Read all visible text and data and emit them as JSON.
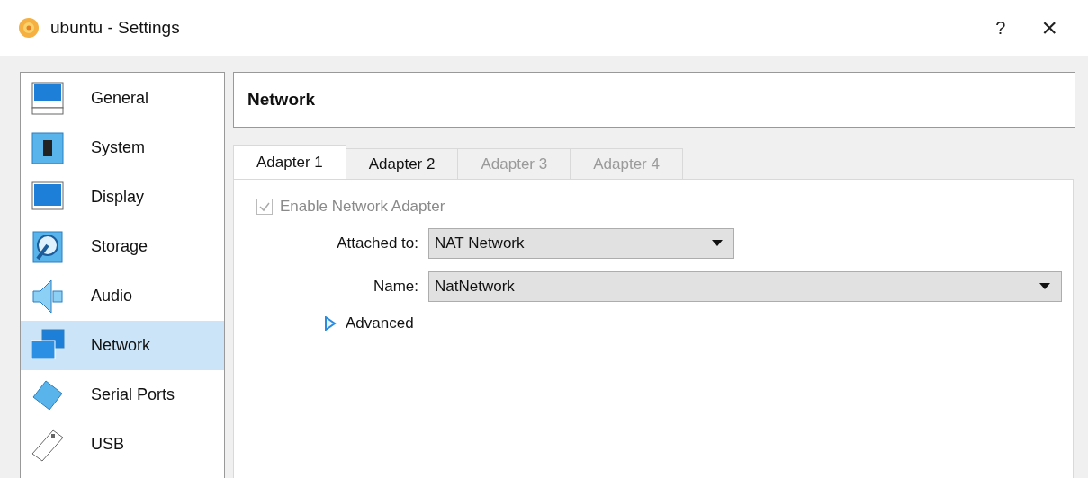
{
  "window": {
    "title": "ubuntu - Settings",
    "help": "?",
    "close": "×"
  },
  "sidebar": {
    "items": [
      {
        "label": "General",
        "selected": false
      },
      {
        "label": "System",
        "selected": false
      },
      {
        "label": "Display",
        "selected": false
      },
      {
        "label": "Storage",
        "selected": false
      },
      {
        "label": "Audio",
        "selected": false
      },
      {
        "label": "Network",
        "selected": true
      },
      {
        "label": "Serial Ports",
        "selected": false
      },
      {
        "label": "USB",
        "selected": false
      }
    ]
  },
  "page": {
    "title": "Network"
  },
  "tabs": [
    {
      "label": "Adapter 1",
      "selected": true,
      "disabled": false
    },
    {
      "label": "Adapter 2",
      "selected": false,
      "disabled": false
    },
    {
      "label": "Adapter 3",
      "selected": false,
      "disabled": true
    },
    {
      "label": "Adapter 4",
      "selected": false,
      "disabled": true
    }
  ],
  "enable_adapter": {
    "label": "Enable Network Adapter",
    "checked": true,
    "disabled": true
  },
  "fields": [
    {
      "label": "Attached to:",
      "value": "NAT Network",
      "wide": false
    },
    {
      "label": "Name:",
      "value": "NatNetwork",
      "wide": true
    }
  ],
  "advanced": {
    "label": "Advanced",
    "expanded": false
  }
}
